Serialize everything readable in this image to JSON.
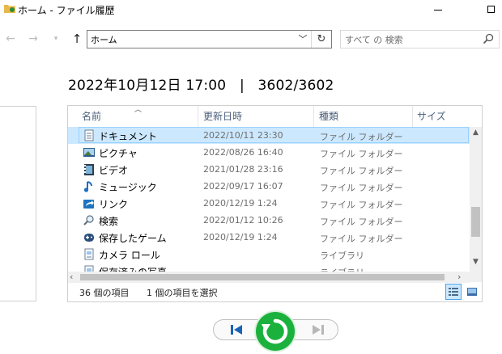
{
  "window": {
    "title": "ホーム - ファイル履歴",
    "icon": "folder-history-icon"
  },
  "navigation": {
    "back_icon": "back-arrow-icon",
    "forward_icon": "forward-arrow-icon",
    "recent_icon": "chevron-down-icon",
    "up_icon": "up-arrow-icon",
    "address": "ホーム",
    "search_placeholder": "すべて の 検索"
  },
  "snapshot": {
    "datetime": "2022年10月12日 17:00",
    "separator": "|",
    "position": "3602/3602"
  },
  "file_list": {
    "columns": [
      "名前",
      "更新日時",
      "種類",
      "サイズ"
    ],
    "sorted_by": "名前",
    "rows": [
      {
        "name": "ドキュメント",
        "date": "2022/10/11 23:30",
        "type": "ファイル フォルダー",
        "icon": "documents-folder-icon",
        "selected": true
      },
      {
        "name": "ピクチャ",
        "date": "2022/08/26 16:40",
        "type": "ファイル フォルダー",
        "icon": "pictures-folder-icon",
        "selected": false
      },
      {
        "name": "ビデオ",
        "date": "2021/01/28 23:16",
        "type": "ファイル フォルダー",
        "icon": "videos-folder-icon",
        "selected": false
      },
      {
        "name": "ミュージック",
        "date": "2022/09/17 16:07",
        "type": "ファイル フォルダー",
        "icon": "music-folder-icon",
        "selected": false
      },
      {
        "name": "リンク",
        "date": "2020/12/19 1:24",
        "type": "ファイル フォルダー",
        "icon": "links-folder-icon",
        "selected": false
      },
      {
        "name": "検索",
        "date": "2022/01/12 10:26",
        "type": "ファイル フォルダー",
        "icon": "searches-folder-icon",
        "selected": false
      },
      {
        "name": "保存したゲーム",
        "date": "2020/12/19 1:24",
        "type": "ファイル フォルダー",
        "icon": "saved-games-folder-icon",
        "selected": false
      },
      {
        "name": "カメラ ロール",
        "date": "",
        "type": "ライブラリ",
        "icon": "library-icon",
        "selected": false
      },
      {
        "name": "保存済みの写真",
        "date": "",
        "type": "ライブラリ",
        "icon": "library-icon",
        "selected": false
      }
    ]
  },
  "status": {
    "item_count": "36 個の項目",
    "selected_count": "1 個の項目を選択"
  },
  "controls": {
    "previous_icon": "skip-previous-icon",
    "restore_icon": "restore-icon",
    "next_icon": "skip-next-icon"
  },
  "colors": {
    "selection": "#cce8ff",
    "restore_button": "#1bb13d",
    "header_text": "#4c607a"
  }
}
